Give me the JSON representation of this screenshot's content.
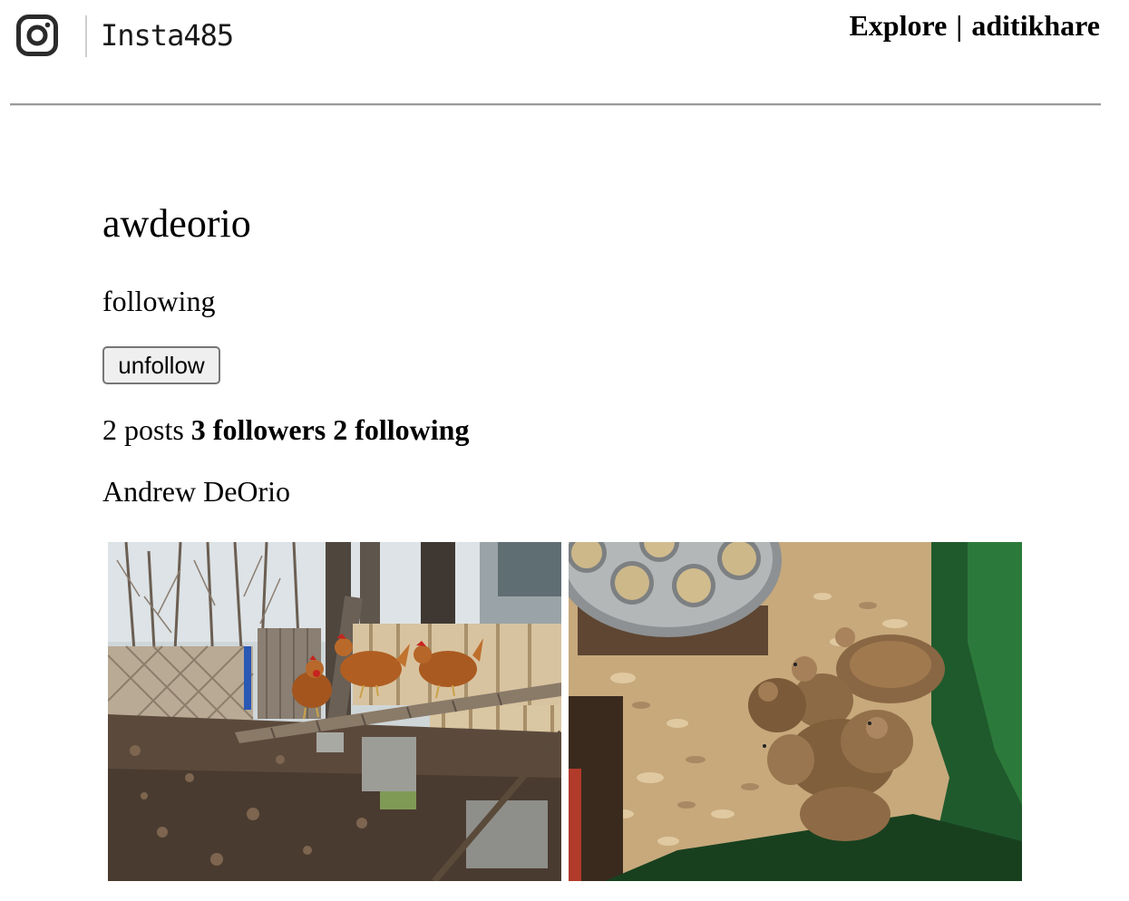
{
  "header": {
    "brand": "Insta485",
    "logo_icon": "instagram-camera-icon",
    "nav": {
      "explore_label": "Explore",
      "separator": "|",
      "user_label": "aditikhare"
    }
  },
  "profile": {
    "username": "awdeorio",
    "relationship": "following",
    "unfollow_label": "unfollow",
    "stats": {
      "posts_text": "2 posts",
      "followers_text": "3 followers",
      "following_text": "2 following"
    },
    "fullname": "Andrew DeOrio"
  },
  "posts": [
    {
      "image": "chickens-on-perch-in-backyard-photo"
    },
    {
      "image": "chicks-in-brooder-with-feeder-photo"
    }
  ]
}
